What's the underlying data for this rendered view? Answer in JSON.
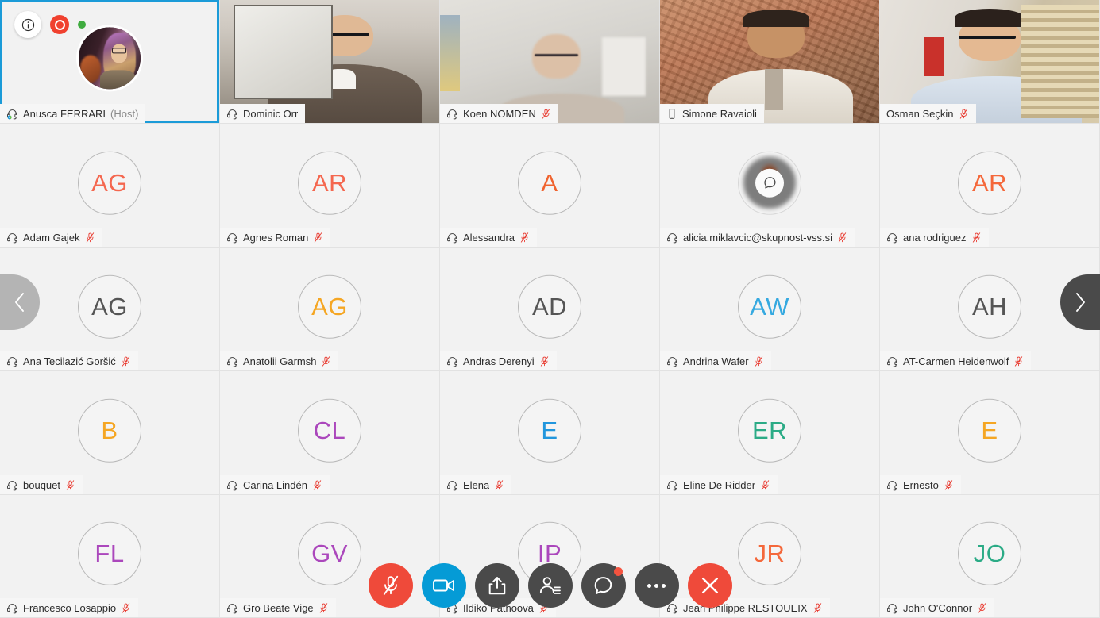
{
  "meeting": {
    "recording_label": "recording-indicator",
    "live_label": "live-indicator",
    "info_label": "meeting-info"
  },
  "colors": {
    "accent_blue": "#1b9bd8",
    "mute_red": "#ef4a3a",
    "camera_blue": "#059bd6",
    "toolbar_grey": "#4a4a4a",
    "cell_bg": "#f2f2f2",
    "namebar_bg": "#f6f6f6"
  },
  "participants": [
    {
      "name": "Anusca FERRARI",
      "suffix": "(Host)",
      "type": "photo",
      "initials": "",
      "initials_color": "",
      "audio_icon": "headset-active-icon",
      "muted": false,
      "active_speaker": true
    },
    {
      "name": "Dominic Orr",
      "suffix": "",
      "type": "video",
      "video": "v-dominic",
      "initials": "",
      "initials_color": "",
      "audio_icon": "headset-icon",
      "muted": false,
      "active_speaker": true
    },
    {
      "name": "Koen NOMDEN",
      "suffix": "",
      "type": "video",
      "video": "v-koen",
      "initials": "",
      "initials_color": "",
      "audio_icon": "headset-icon",
      "muted": true,
      "active_speaker": false
    },
    {
      "name": "Simone Ravaioli",
      "suffix": "",
      "type": "video",
      "video": "v-simone",
      "initials": "",
      "initials_color": "",
      "audio_icon": "mobile-icon",
      "muted": false,
      "active_speaker": false
    },
    {
      "name": "Osman Seçkin",
      "suffix": "",
      "type": "video",
      "video": "v-osman",
      "initials": "",
      "initials_color": "",
      "audio_icon": "none",
      "muted": true,
      "active_speaker": false
    },
    {
      "name": "Adam Gajek",
      "suffix": "",
      "type": "initials",
      "initials": "AG",
      "initials_color": "#f4674f",
      "audio_icon": "headset-icon",
      "muted": true,
      "active_speaker": false
    },
    {
      "name": "Agnes Roman",
      "suffix": "",
      "type": "initials",
      "initials": "AR",
      "initials_color": "#f4674f",
      "audio_icon": "headset-icon",
      "muted": true,
      "active_speaker": false
    },
    {
      "name": "Alessandra",
      "suffix": "",
      "type": "initials",
      "initials": "A",
      "initials_color": "#f0632f",
      "audio_icon": "headset-icon",
      "muted": true,
      "active_speaker": false
    },
    {
      "name": "alicia.miklavcic@skupnost-vss.si",
      "suffix": "",
      "type": "bubble",
      "initials": "",
      "initials_color": "",
      "audio_icon": "headset-icon",
      "muted": true,
      "active_speaker": false
    },
    {
      "name": "ana rodriguez",
      "suffix": "",
      "type": "initials",
      "initials": "AR",
      "initials_color": "#f4683b",
      "audio_icon": "headset-icon",
      "muted": true,
      "active_speaker": false
    },
    {
      "name": "Ana Tecilazić Goršić",
      "suffix": "",
      "type": "initials",
      "initials": "AG",
      "initials_color": "#555555",
      "audio_icon": "headset-icon",
      "muted": true,
      "active_speaker": false
    },
    {
      "name": "Anatolii Garmsh",
      "suffix": "",
      "type": "initials",
      "initials": "AG",
      "initials_color": "#f5a623",
      "audio_icon": "headset-icon",
      "muted": true,
      "active_speaker": false
    },
    {
      "name": "Andras Derenyi",
      "suffix": "",
      "type": "initials",
      "initials": "AD",
      "initials_color": "#555555",
      "audio_icon": "headset-icon",
      "muted": true,
      "active_speaker": false
    },
    {
      "name": "Andrina Wafer",
      "suffix": "",
      "type": "initials",
      "initials": "AW",
      "initials_color": "#35a9e0",
      "audio_icon": "headset-icon",
      "muted": true,
      "active_speaker": false
    },
    {
      "name": "AT-Carmen Heidenwolf",
      "suffix": "",
      "type": "initials",
      "initials": "AH",
      "initials_color": "#555555",
      "audio_icon": "headset-icon",
      "muted": true,
      "active_speaker": false
    },
    {
      "name": "bouquet",
      "suffix": "",
      "type": "initials",
      "initials": "B",
      "initials_color": "#f5a623",
      "audio_icon": "headset-icon",
      "muted": true,
      "active_speaker": false
    },
    {
      "name": "Carina Lindén",
      "suffix": "",
      "type": "initials",
      "initials": "CL",
      "initials_color": "#ab47bc",
      "audio_icon": "headset-icon",
      "muted": true,
      "active_speaker": false
    },
    {
      "name": "Elena",
      "suffix": "",
      "type": "initials",
      "initials": "E",
      "initials_color": "#2196dd",
      "audio_icon": "headset-icon",
      "muted": true,
      "active_speaker": false
    },
    {
      "name": "Eline De Ridder",
      "suffix": "",
      "type": "initials",
      "initials": "ER",
      "initials_color": "#2bab86",
      "audio_icon": "headset-icon",
      "muted": true,
      "active_speaker": false
    },
    {
      "name": "Ernesto",
      "suffix": "",
      "type": "initials",
      "initials": "E",
      "initials_color": "#f5a623",
      "audio_icon": "headset-icon",
      "muted": true,
      "active_speaker": false
    },
    {
      "name": "Francesco Losappio",
      "suffix": "",
      "type": "initials",
      "initials": "FL",
      "initials_color": "#ab47bc",
      "audio_icon": "headset-icon",
      "muted": true,
      "active_speaker": false
    },
    {
      "name": "Gro Beate Vige",
      "suffix": "",
      "type": "initials",
      "initials": "GV",
      "initials_color": "#ab47bc",
      "audio_icon": "headset-icon",
      "muted": true,
      "active_speaker": false
    },
    {
      "name": "Ildiko Pathoova",
      "suffix": "",
      "type": "initials",
      "initials": "IP",
      "initials_color": "#ab47bc",
      "audio_icon": "headset-icon",
      "muted": true,
      "active_speaker": false
    },
    {
      "name": "Jean Philippe RESTOUEIX",
      "suffix": "",
      "type": "initials",
      "initials": "JR",
      "initials_color": "#f4683b",
      "audio_icon": "headset-icon",
      "muted": true,
      "active_speaker": false
    },
    {
      "name": "John O'Connor",
      "suffix": "",
      "type": "initials",
      "initials": "JO",
      "initials_color": "#2bab86",
      "audio_icon": "headset-icon",
      "muted": true,
      "active_speaker": false
    }
  ],
  "navigation": {
    "prev_label": "previous-page",
    "next_label": "next-page"
  },
  "toolbar": [
    {
      "id": "microphone",
      "label": "Microphone",
      "icon": "mic-muted-icon",
      "style": "red"
    },
    {
      "id": "camera",
      "label": "Camera",
      "icon": "camera-icon",
      "style": "blue"
    },
    {
      "id": "share",
      "label": "Share screen",
      "icon": "share-icon",
      "style": "grey"
    },
    {
      "id": "participants",
      "label": "Participants",
      "icon": "participants-icon",
      "style": "grey"
    },
    {
      "id": "chat",
      "label": "Chat",
      "icon": "chat-icon",
      "style": "grey",
      "badge": true
    },
    {
      "id": "more",
      "label": "More options",
      "icon": "more-icon",
      "style": "grey"
    },
    {
      "id": "leave",
      "label": "Leave meeting",
      "icon": "end-call-icon",
      "style": "red"
    }
  ]
}
